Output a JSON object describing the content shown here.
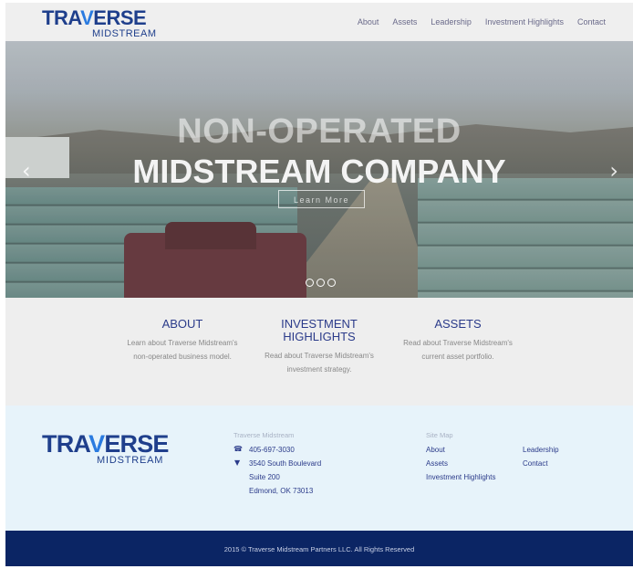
{
  "brand": {
    "name_main_left": "TRA",
    "name_main_mark": "V",
    "name_main_right": "ERSE",
    "name_sub": "MIDSTREAM"
  },
  "nav": {
    "items": [
      "About",
      "Assets",
      "Leadership",
      "Investment Highlights",
      "Contact"
    ]
  },
  "hero": {
    "title_line1": "NON-OPERATED",
    "title_line2": "MIDSTREAM COMPANY",
    "button": "Learn More",
    "prev_icon": "chevron-left-icon",
    "next_icon": "chevron-right-icon",
    "slide_count": 3
  },
  "features": [
    {
      "title": "ABOUT",
      "desc": "Learn about Traverse Midstream's non-operated business model."
    },
    {
      "title": "INVESTMENT HIGHLIGHTS",
      "desc": "Read about Traverse Midstream's investment strategy."
    },
    {
      "title": "ASSETS",
      "desc": "Read about Traverse Midstream's current asset portfolio."
    }
  ],
  "footer": {
    "contact_heading": "Traverse Midstream",
    "phone": "405-697-3030",
    "address_line1": "3540 South Boulevard",
    "address_line2": "Suite 200",
    "address_line3": "Edmond, OK 73013",
    "sitemap_heading": "Site Map",
    "sitemap_col1": [
      "About",
      "Assets",
      "Investment Highlights"
    ],
    "sitemap_col2": [
      "Leadership",
      "Contact"
    ]
  },
  "copyright": "2015 © Traverse Midstream Partners LLC. All Rights Reserved",
  "colors": {
    "brand_blue": "#1f3f8c",
    "accent_blue": "#2a7be0",
    "footer_bg": "#e7f3fa",
    "copyright_bg": "#0b2564"
  }
}
